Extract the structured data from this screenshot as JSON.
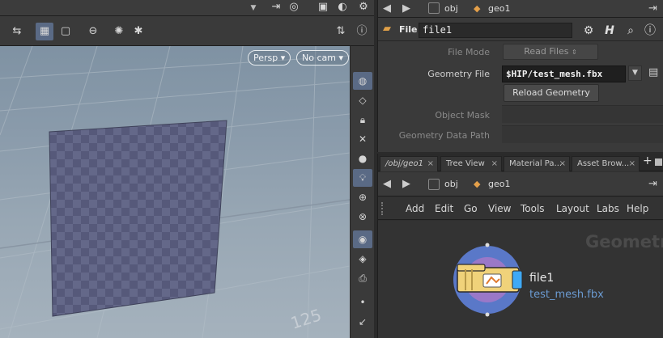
{
  "viewport": {
    "persp_label": "Persp",
    "cam_label": "No cam",
    "grid_labels": [
      "125"
    ]
  },
  "parameters": {
    "path": {
      "obj": "obj",
      "geo": "geo1"
    },
    "node_type": "File",
    "node_name": "file1",
    "fields": {
      "file_mode_label": "File Mode",
      "file_mode_value": "Read Files",
      "geometry_file_label": "Geometry File",
      "geometry_file_value": "$HIP/test_mesh.fbx",
      "reload_label": "Reload Geometry",
      "object_mask_label": "Object Mask",
      "geo_data_path_label": "Geometry Data Path"
    }
  },
  "network": {
    "tabs": [
      {
        "label": "/obj/geo1",
        "close": "×"
      },
      {
        "label": "Tree View",
        "close": "×"
      },
      {
        "label": "Material Pa...",
        "close": "×"
      },
      {
        "label": "Asset Brow...",
        "close": "×"
      }
    ],
    "add_tab": "+",
    "path": {
      "obj": "obj",
      "geo": "geo1"
    },
    "menu": [
      "Add",
      "Edit",
      "Go",
      "View",
      "Tools",
      "Layout",
      "Labs",
      "Help"
    ],
    "watermark": "Geometr",
    "node": {
      "name": "file1",
      "file": "test_mesh.fbx"
    }
  },
  "colors": {
    "accent": "#5a6a85",
    "link": "#6b9bd2",
    "node_ring": "#5a78c8",
    "node_body": "#f0d27a"
  }
}
